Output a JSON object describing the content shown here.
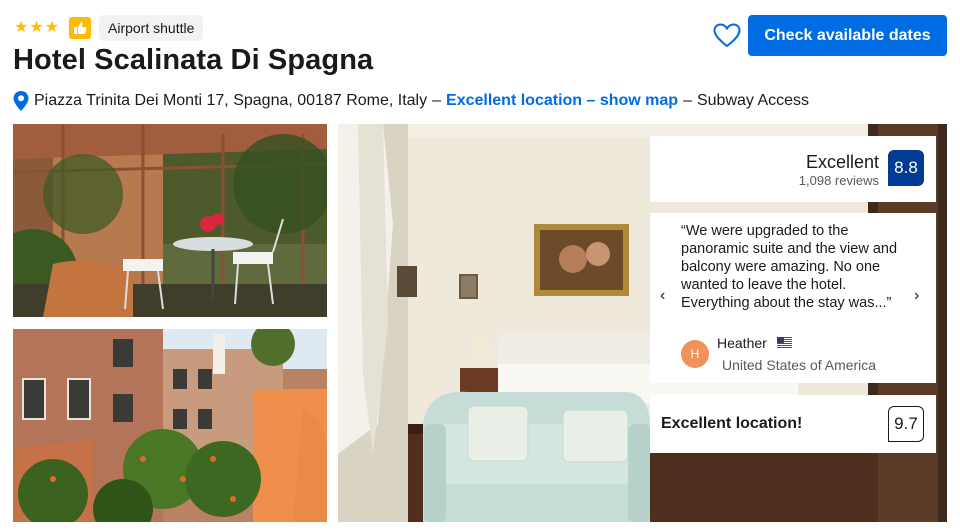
{
  "header": {
    "star_rating": 3,
    "stars": [
      "★",
      "★",
      "★"
    ],
    "badge_label": "Airport shuttle",
    "hotel_name": "Hotel Scalinata Di Spagna",
    "cta_label": "Check available dates",
    "favorite_icon": "heart-outline-icon",
    "thumb_icon": "thumbs-up-icon"
  },
  "address": {
    "icon": "map-pin-icon",
    "text": "Piazza Trinita Dei Monti 17, Spagna, 00187 Rome, Italy",
    "separator": "–",
    "location_link": "Excellent location – show map",
    "extra": "Subway Access"
  },
  "rating": {
    "label": "Excellent",
    "reviews": "1,098 reviews",
    "score": "8.8"
  },
  "review": {
    "text": "“We were upgraded to the panoramic suite and the view and balcony were amazing. No one wanted to leave the hotel. Everything about the stay was...”",
    "prev_arrow": "‹",
    "next_arrow": "›",
    "avatar_initial": "H",
    "reviewer_name": "Heather",
    "reviewer_country": "United States of America",
    "flag_icon": "us-flag-icon"
  },
  "location": {
    "label": "Excellent location!",
    "score": "9.7"
  },
  "colors": {
    "brand_blue": "#006ce4",
    "score_navy": "#003b95",
    "star_yellow": "#febb02",
    "avatar_orange": "#f0935a"
  }
}
